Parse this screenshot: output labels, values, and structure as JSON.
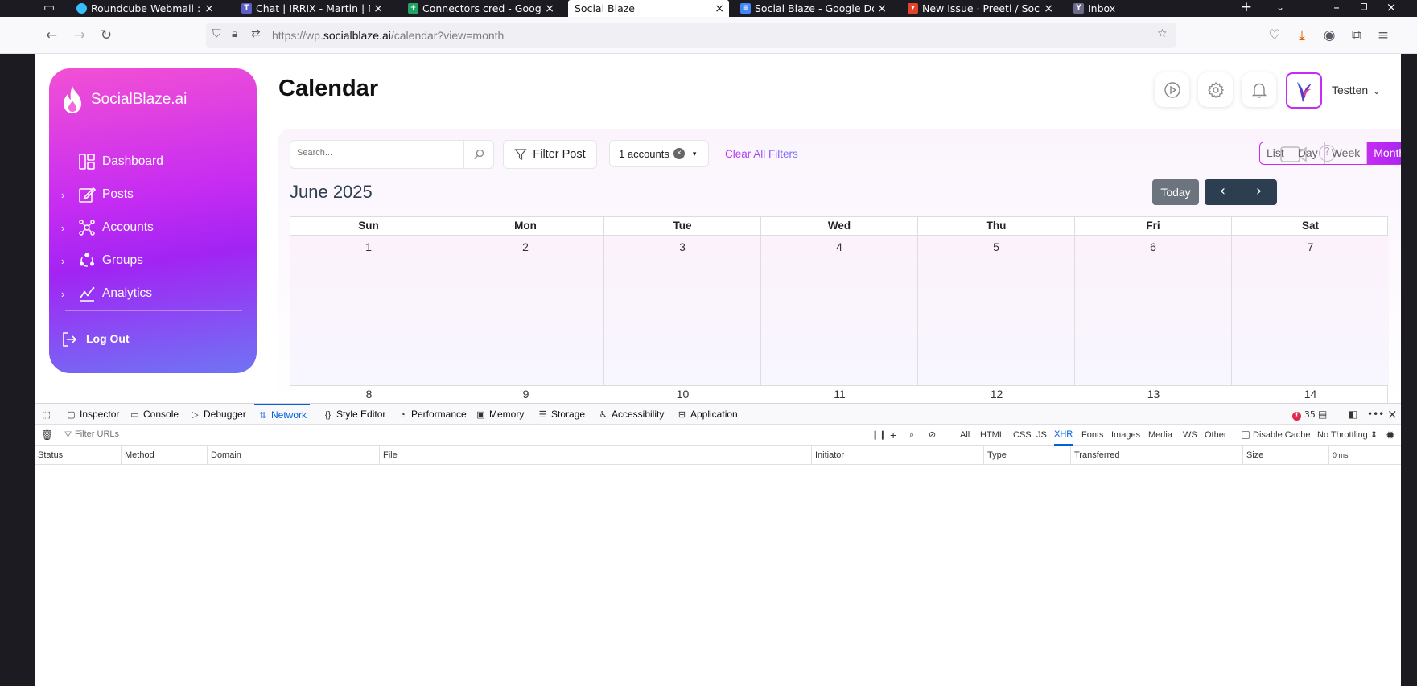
{
  "browser": {
    "tabs": [
      {
        "title": "Roundcube Webmail :: Inbox",
        "active": false
      },
      {
        "title": "Chat | IRRIX - Martin | Microsoft Teams",
        "active": false
      },
      {
        "title": "Connectors cred - Google Sheets",
        "active": false
      },
      {
        "title": "Social Blaze",
        "active": true
      },
      {
        "title": "Social Blaze - Google Docs",
        "active": false
      },
      {
        "title": "New Issue · Preeti / Social",
        "active": false
      },
      {
        "title": "Inbox",
        "active": false
      }
    ],
    "url_prefix": "https://wp.",
    "url_domain": "socialblaze.ai",
    "url_path": "/calendar?view=month"
  },
  "sidebar": {
    "logo": "SocialBlaze.ai",
    "items": [
      {
        "label": "Dashboard",
        "icon": "dashboard-icon",
        "expandable": false
      },
      {
        "label": "Posts",
        "icon": "edit-icon",
        "expandable": true
      },
      {
        "label": "Accounts",
        "icon": "network-icon",
        "expandable": true
      },
      {
        "label": "Groups",
        "icon": "groups-icon",
        "expandable": true
      },
      {
        "label": "Analytics",
        "icon": "chart-icon",
        "expandable": true
      }
    ],
    "logout": "Log Out"
  },
  "header": {
    "title": "Calendar",
    "user": "Testten"
  },
  "toolbar": {
    "search_placeholder": "Search...",
    "filter_label": "Filter Post",
    "accounts_label": "1 accounts",
    "clear_label": "Clear All Filters",
    "views": [
      "List",
      "Day",
      "Week",
      "Month"
    ],
    "active_view": "Month",
    "today_label": "Today"
  },
  "calendar": {
    "month_title": "June 2025",
    "days": [
      "Sun",
      "Mon",
      "Tue",
      "Wed",
      "Thu",
      "Fri",
      "Sat"
    ],
    "week1": [
      "1",
      "2",
      "3",
      "4",
      "5",
      "6",
      "7"
    ],
    "week2": [
      "8",
      "9",
      "10",
      "11",
      "12",
      "13",
      "14"
    ]
  },
  "devtools": {
    "tabs": [
      "Inspector",
      "Console",
      "Debugger",
      "Network",
      "Style Editor",
      "Performance",
      "Memory",
      "Storage",
      "Accessibility",
      "Application"
    ],
    "active_tab": "Network",
    "error_count": "35",
    "filter_placeholder": "Filter URLs",
    "type_filters": [
      "All",
      "HTML",
      "CSS",
      "JS",
      "XHR",
      "Fonts",
      "Images",
      "Media",
      "WS",
      "Other"
    ],
    "active_filter": "XHR",
    "disable_cache": "Disable Cache",
    "throttling": "No Throttling",
    "columns": [
      "Status",
      "Method",
      "Domain",
      "File",
      "Initiator",
      "Type",
      "Transferred",
      "Size",
      "0 ms"
    ]
  }
}
